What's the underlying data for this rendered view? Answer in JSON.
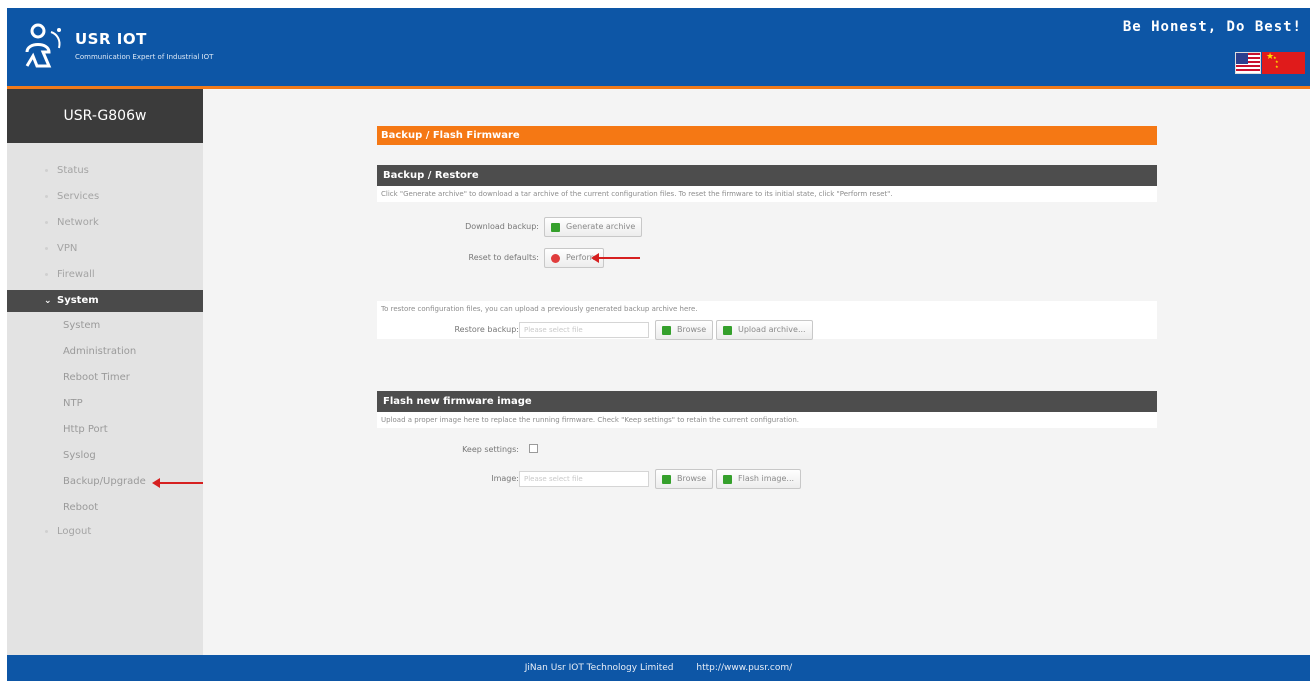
{
  "header": {
    "brand": "USR IOT",
    "tagline": "Communication Expert of Industrial IOT",
    "slogan": "Be Honest, Do Best!",
    "flags": [
      "us-flag",
      "cn-flag"
    ]
  },
  "sidebar": {
    "device_name": "USR-G806w",
    "items": [
      {
        "label": "Status"
      },
      {
        "label": "Services"
      },
      {
        "label": "Network"
      },
      {
        "label": "VPN"
      },
      {
        "label": "Firewall"
      },
      {
        "label": "System"
      },
      {
        "label": "Logout"
      }
    ],
    "sub_items": [
      {
        "label": "System"
      },
      {
        "label": "Administration"
      },
      {
        "label": "Reboot Timer"
      },
      {
        "label": "NTP"
      },
      {
        "label": "Http Port"
      },
      {
        "label": "Syslog"
      },
      {
        "label": "Backup/Upgrade"
      },
      {
        "label": "Reboot"
      }
    ]
  },
  "main": {
    "page_title": "Backup / Flash Firmware",
    "backup": {
      "title": "Backup / Restore",
      "description": "Click \"Generate archive\" to download a tar archive of the current configuration files. To reset the firmware to its initial state, click \"Perform reset\".",
      "download_label": "Download backup:",
      "generate_button": "Generate archive",
      "reset_label": "Reset to defaults:",
      "perform_button": "Perform",
      "restore_description": "To restore configuration files, you can upload a previously generated backup archive here.",
      "restore_label": "Restore backup:",
      "file_placeholder": "Please select file",
      "browse_button": "Browse",
      "upload_button": "Upload archive..."
    },
    "flash": {
      "title": "Flash new firmware image",
      "description": "Upload a proper image here to replace the running firmware. Check \"Keep settings\" to retain the current configuration.",
      "keep_label": "Keep settings:",
      "image_label": "Image:",
      "file_placeholder": "Please select file",
      "browse_button": "Browse",
      "flash_button": "Flash image..."
    }
  },
  "footer": {
    "company": "JiNan Usr IOT Technology Limited",
    "url": "http://www.pusr.com/"
  },
  "colors": {
    "header": "#0d56a6",
    "accent": "#f57814",
    "section_header": "#4d4d4d",
    "arrow": "#d62020"
  }
}
